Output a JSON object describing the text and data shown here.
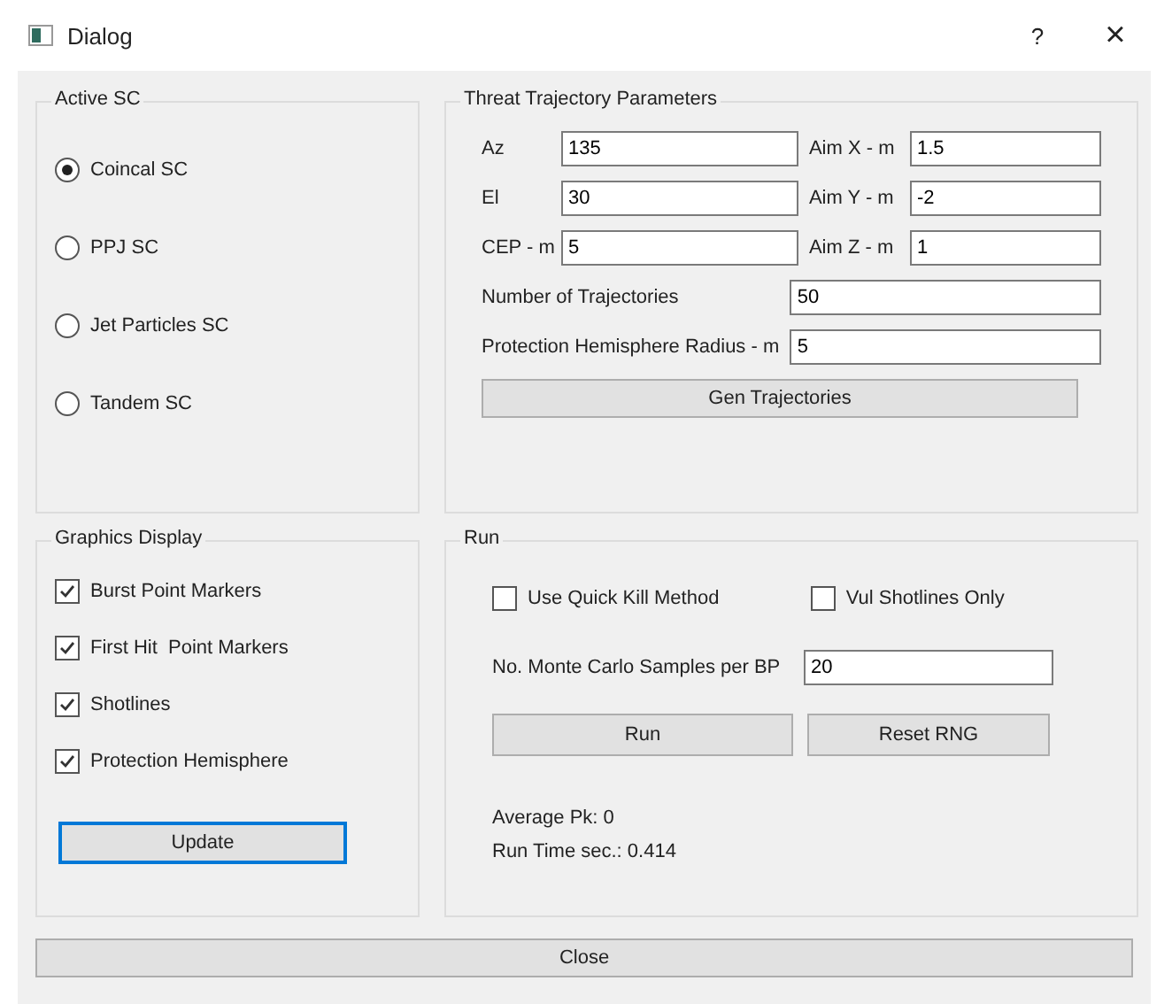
{
  "window": {
    "title": "Dialog",
    "help": "?",
    "close": "×"
  },
  "active_sc": {
    "title": "Active SC",
    "options": [
      {
        "label": "Coincal SC",
        "selected": true
      },
      {
        "label": "PPJ SC",
        "selected": false
      },
      {
        "label": "Jet Particles SC",
        "selected": false
      },
      {
        "label": "Tandem SC",
        "selected": false
      }
    ]
  },
  "threat": {
    "title": "Threat Trajectory Parameters",
    "pairs": [
      [
        {
          "label": "Az",
          "value": "135"
        },
        {
          "label": "Aim X - m",
          "value": "1.5"
        }
      ],
      [
        {
          "label": "El",
          "value": "30"
        },
        {
          "label": "Aim Y - m",
          "value": "-2"
        }
      ],
      [
        {
          "label": "CEP - m",
          "value": "5"
        },
        {
          "label": "Aim Z - m",
          "value": "1"
        }
      ]
    ],
    "wide_fields": [
      {
        "label": "Number of Trajectories",
        "value": "50"
      },
      {
        "label": "Protection Hemisphere Radius - m",
        "value": "5"
      }
    ],
    "button": "Gen Trajectories"
  },
  "graphics": {
    "title": "Graphics Display",
    "checks": [
      {
        "label": "Burst Point Markers",
        "checked": true
      },
      {
        "label": "First Hit  Point Markers",
        "checked": true
      },
      {
        "label": "Shotlines",
        "checked": true
      },
      {
        "label": "Protection Hemisphere",
        "checked": true
      }
    ],
    "button": {
      "label": "Update",
      "focused": true
    }
  },
  "run": {
    "title": "Run",
    "checks": [
      {
        "label": "Use Quick Kill Method",
        "checked": false
      },
      {
        "label": "Vul Shotlines Only",
        "checked": false
      }
    ],
    "samples": {
      "label": "No. Monte Carlo Samples per BP",
      "value": "20"
    },
    "buttons": [
      "Run",
      "Reset RNG"
    ],
    "results": [
      "Average Pk: 0",
      "Run Time sec.: 0.414"
    ]
  },
  "close_button": "Close"
}
